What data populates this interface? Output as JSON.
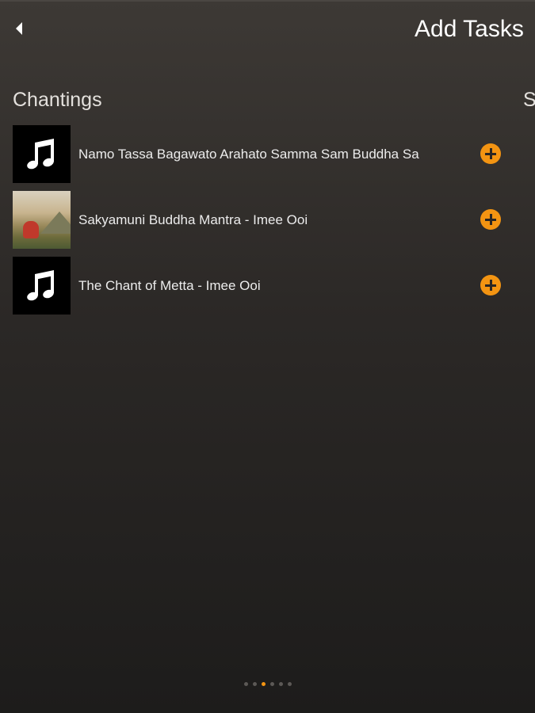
{
  "header": {
    "title": "Add Tasks",
    "back_icon": "chevron-left-icon"
  },
  "section": {
    "title": "Chantings",
    "next_peek": "S"
  },
  "items": [
    {
      "label": "Namo Tassa Bagawato Arahato Samma Sam Buddha Sa",
      "thumbnail": "music-note-icon",
      "action_icon": "plus-circle-icon"
    },
    {
      "label": "Sakyamuni Buddha Mantra - Imee Ooi",
      "thumbnail": "photo-thumbnail",
      "action_icon": "plus-circle-icon"
    },
    {
      "label": "The Chant of Metta - Imee Ooi",
      "thumbnail": "music-note-icon",
      "action_icon": "plus-circle-icon"
    }
  ],
  "pagination": {
    "count": 6,
    "active_index": 2
  },
  "colors": {
    "accent": "#f39412",
    "background_top": "#3d3935",
    "background_bottom": "#1d1c1b"
  }
}
